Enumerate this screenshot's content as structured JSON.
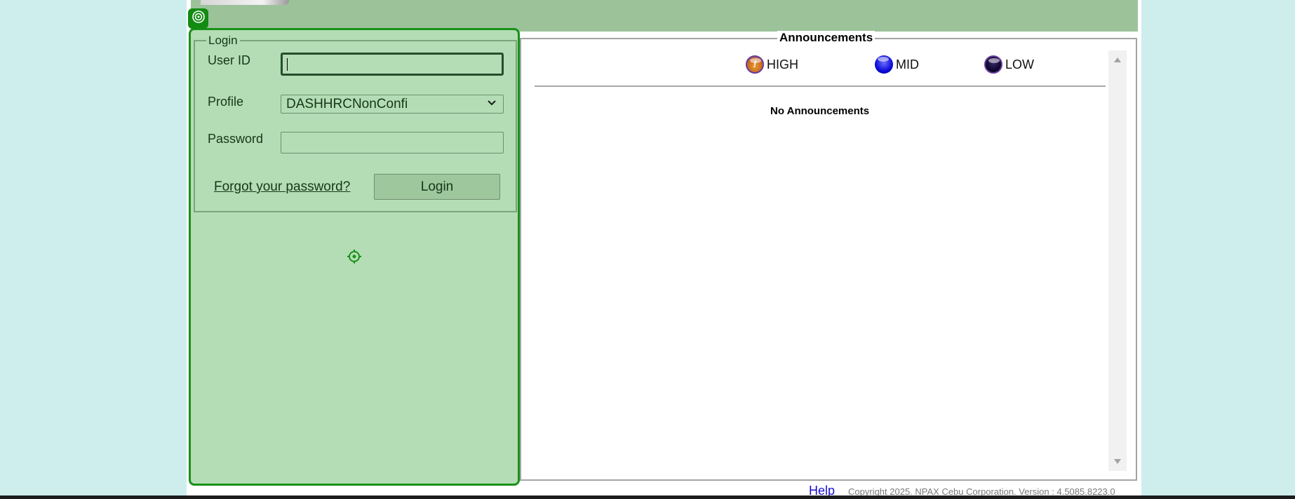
{
  "login": {
    "legend": "Login",
    "userid_label": "User ID",
    "userid_value": "",
    "profile_label": "Profile",
    "profile_value": "DASHHRCNonConfi",
    "password_label": "Password",
    "password_value": "",
    "forgot_link": "Forgot your password?",
    "login_button": "Login"
  },
  "announcements": {
    "title": "Announcements",
    "legend": [
      {
        "label": "HIGH",
        "icon": "high-priority-icon",
        "badge": "!"
      },
      {
        "label": "MID",
        "icon": "mid-priority-icon"
      },
      {
        "label": "LOW",
        "icon": "low-priority-icon"
      }
    ],
    "empty_text": "No Announcements"
  },
  "footer": {
    "help_link": "Help",
    "copyright": "Copyright 2025. NPAX Cebu Corporation.  Version : 4.5085.8223.0"
  },
  "colors": {
    "page_bg": "#cdeeed",
    "header_bar": "#9cc29a",
    "panel_bg": "#b4ddb5",
    "panel_border": "#189118",
    "link_blue": "#1a0dcc"
  }
}
